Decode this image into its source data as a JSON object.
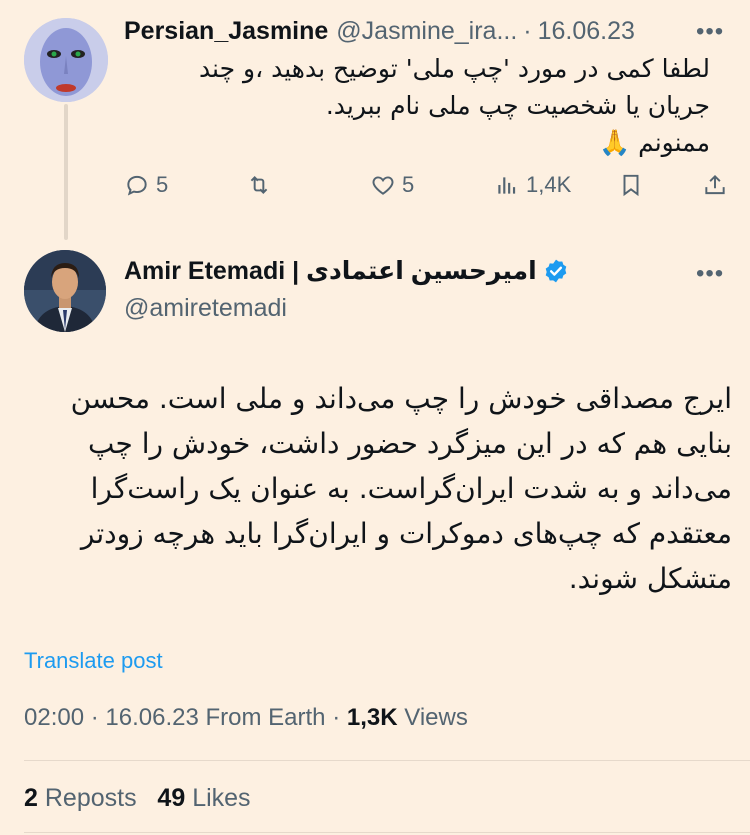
{
  "reply": {
    "name": "Persian_Jasmine",
    "handle": "@Jasmine_ira...",
    "separator": "·",
    "date": "16.06.23",
    "body_line1": "لطفا کمی در مورد 'چپ ملی' توضیح بدهید ،و چند",
    "body_line2": "جریان یا شخصیت چپ ملی نام ببرید.",
    "body_line3": "ممنونم 🙏",
    "actions": {
      "replies": "5",
      "reposts": "",
      "likes": "5",
      "views": "1,4K"
    }
  },
  "main": {
    "name": "Amir Etemadi | امیرحسین اعتمادی",
    "handle": "@amiretemadi",
    "body": "ایرج مصداقی خودش را چپ می‌داند و ملی است. محسن بنایی هم که در این میزگرد حضور داشت، خودش را چپ می‌داند و به شدت ایران‌گراست. به عنوان یک راست‌گرا معتقدم که چپ‌های دموکرات و ایران‌گرا باید هرچه زودتر متشکل شوند.",
    "translate": "Translate post",
    "time": "02:00",
    "dot1": "·",
    "date": "16.06.23",
    "source": "From Earth",
    "dot2": "·",
    "views_count": "1,3K",
    "views_label": "Views",
    "reposts_count": "2",
    "reposts_label": "Reposts",
    "likes_count": "49",
    "likes_label": "Likes"
  },
  "icons": {
    "reply": "reply-icon",
    "repost": "repost-icon",
    "like": "heart-icon",
    "views": "analytics-icon",
    "bookmark": "bookmark-icon",
    "share": "share-icon",
    "more": "more-icon",
    "verified": "verified-badge-icon"
  },
  "colors": {
    "background": "#fdf0e1",
    "accent": "#1d9bf0",
    "secondary_text": "#536471"
  }
}
